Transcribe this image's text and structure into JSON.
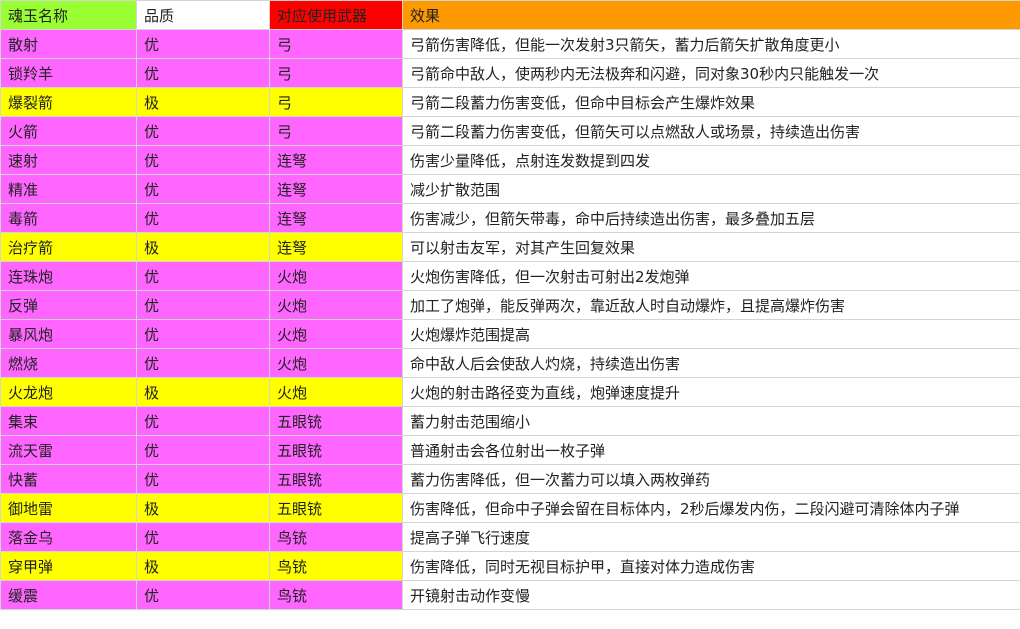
{
  "colors": {
    "header_name": "#99ff33",
    "header_quality": "#ffffff",
    "header_weapon": "#ff0000",
    "header_effect": "#ff9900",
    "row_common": "#ff66ff",
    "row_rare": "#ffff00",
    "effect_cell": "#ffffff"
  },
  "table": {
    "headers": [
      "魂玉名称",
      "品质",
      "对应使用武器",
      "效果"
    ],
    "rows": [
      {
        "name": "散射",
        "quality": "优",
        "weapon": "弓",
        "effect": "弓箭伤害降低，但能一次发射3只箭矢，蓄力后箭矢扩散角度更小",
        "tier": "common"
      },
      {
        "name": "锁羚羊",
        "quality": "优",
        "weapon": "弓",
        "effect": "弓箭命中敌人，使两秒内无法极奔和闪避，同对象30秒内只能触发一次",
        "tier": "common"
      },
      {
        "name": "爆裂箭",
        "quality": "极",
        "weapon": "弓",
        "effect": "弓箭二段蓄力伤害变低，但命中目标会产生爆炸效果",
        "tier": "rare"
      },
      {
        "name": "火箭",
        "quality": "优",
        "weapon": "弓",
        "effect": "弓箭二段蓄力伤害变低，但箭矢可以点燃敌人或场景，持续造出伤害",
        "tier": "common"
      },
      {
        "name": "速射",
        "quality": "优",
        "weapon": "连弩",
        "effect": "伤害少量降低，点射连发数提到四发",
        "tier": "common"
      },
      {
        "name": "精准",
        "quality": "优",
        "weapon": "连弩",
        "effect": "减少扩散范围",
        "tier": "common"
      },
      {
        "name": "毒箭",
        "quality": "优",
        "weapon": "连弩",
        "effect": "伤害减少，但箭矢带毒，命中后持续造出伤害，最多叠加五层",
        "tier": "common"
      },
      {
        "name": "治疗箭",
        "quality": "极",
        "weapon": "连弩",
        "effect": "可以射击友军，对其产生回复效果",
        "tier": "rare"
      },
      {
        "name": "连珠炮",
        "quality": "优",
        "weapon": "火炮",
        "effect": "火炮伤害降低，但一次射击可射出2发炮弹",
        "tier": "common"
      },
      {
        "name": "反弹",
        "quality": "优",
        "weapon": "火炮",
        "effect": "加工了炮弹，能反弹两次，靠近敌人时自动爆炸，且提高爆炸伤害",
        "tier": "common"
      },
      {
        "name": "暴风炮",
        "quality": "优",
        "weapon": "火炮",
        "effect": "火炮爆炸范围提高",
        "tier": "common"
      },
      {
        "name": "燃烧",
        "quality": "优",
        "weapon": "火炮",
        "effect": "命中敌人后会使敌人灼烧，持续造出伤害",
        "tier": "common"
      },
      {
        "name": "火龙炮",
        "quality": "极",
        "weapon": "火炮",
        "effect": "火炮的射击路径变为直线，炮弹速度提升",
        "tier": "rare"
      },
      {
        "name": "集束",
        "quality": "优",
        "weapon": "五眼铳",
        "effect": "蓄力射击范围缩小",
        "tier": "common"
      },
      {
        "name": "流天雷",
        "quality": "优",
        "weapon": "五眼铳",
        "effect": "普通射击会各位射出一枚子弹",
        "tier": "common"
      },
      {
        "name": "快蓄",
        "quality": "优",
        "weapon": "五眼铳",
        "effect": "蓄力伤害降低，但一次蓄力可以填入两枚弹药",
        "tier": "common"
      },
      {
        "name": "御地雷",
        "quality": "极",
        "weapon": "五眼铳",
        "effect": "伤害降低，但命中子弹会留在目标体内，2秒后爆发内伤，二段闪避可清除体内子弹",
        "tier": "rare"
      },
      {
        "name": "落金乌",
        "quality": "优",
        "weapon": "鸟铳",
        "effect": "提高子弹飞行速度",
        "tier": "common"
      },
      {
        "name": "穿甲弹",
        "quality": "极",
        "weapon": "鸟铳",
        "effect": "伤害降低，同时无视目标护甲，直接对体力造成伤害",
        "tier": "rare"
      },
      {
        "name": "缓震",
        "quality": "优",
        "weapon": "鸟铳",
        "effect": "开镜射击动作变慢",
        "tier": "common"
      }
    ]
  }
}
